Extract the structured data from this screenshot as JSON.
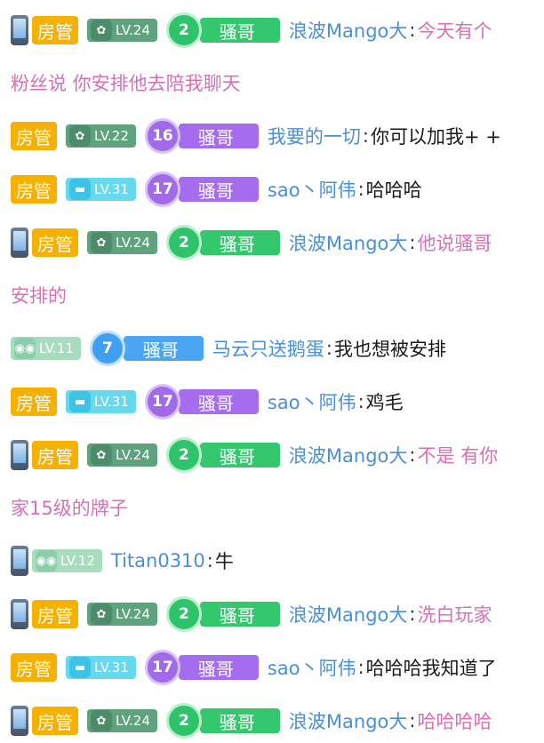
{
  "colors": {
    "username": "#4a8fd8",
    "message_pink": "#d870b4",
    "message_dark": "#1a1a1a",
    "admin_badge": "#f6b100",
    "fan_green": "#33c86e",
    "fan_purple": "#a56cf0",
    "fan_blue": "#4aa6f2"
  },
  "messages": [
    {
      "admin": "房管",
      "level": "LV.24",
      "fan_num": "2",
      "fan_name": "骚哥",
      "user": "浪波Mango大",
      "text": "今天有个",
      "cont": "粉丝说 你安排他去陪我聊天"
    },
    {
      "admin": "房管",
      "level": "LV.22",
      "fan_num": "16",
      "fan_name": "骚哥",
      "user": "我要的一切",
      "text": "你可以加我+ +"
    },
    {
      "admin": "房管",
      "level": "LV.31",
      "fan_num": "17",
      "fan_name": "骚哥",
      "user": "sao丶阿伟",
      "text": "哈哈哈"
    },
    {
      "admin": "房管",
      "level": "LV.24",
      "fan_num": "2",
      "fan_name": "骚哥",
      "user": "浪波Mango大",
      "text": "他说骚哥",
      "cont": "安排的"
    },
    {
      "level": "LV.11",
      "fan_num": "7",
      "fan_name": "骚哥",
      "user": "马云只送鹅蛋",
      "text": "我也想被安排"
    },
    {
      "admin": "房管",
      "level": "LV.31",
      "fan_num": "17",
      "fan_name": "骚哥",
      "user": "sao丶阿伟",
      "text": "鸡毛"
    },
    {
      "admin": "房管",
      "level": "LV.24",
      "fan_num": "2",
      "fan_name": "骚哥",
      "user": "浪波Mango大",
      "text": "不是 有你",
      "cont": "家15级的牌子"
    },
    {
      "level": "LV.12",
      "user": "Titan0310",
      "text": "牛"
    },
    {
      "admin": "房管",
      "level": "LV.24",
      "fan_num": "2",
      "fan_name": "骚哥",
      "user": "浪波Mango大",
      "text": "洗白玩家"
    },
    {
      "admin": "房管",
      "level": "LV.31",
      "fan_num": "17",
      "fan_name": "骚哥",
      "user": "sao丶阿伟",
      "text": "哈哈哈我知道了"
    },
    {
      "admin": "房管",
      "level": "LV.24",
      "fan_num": "2",
      "fan_name": "骚哥",
      "user": "浪波Mango大",
      "text": "哈哈哈哈"
    }
  ]
}
